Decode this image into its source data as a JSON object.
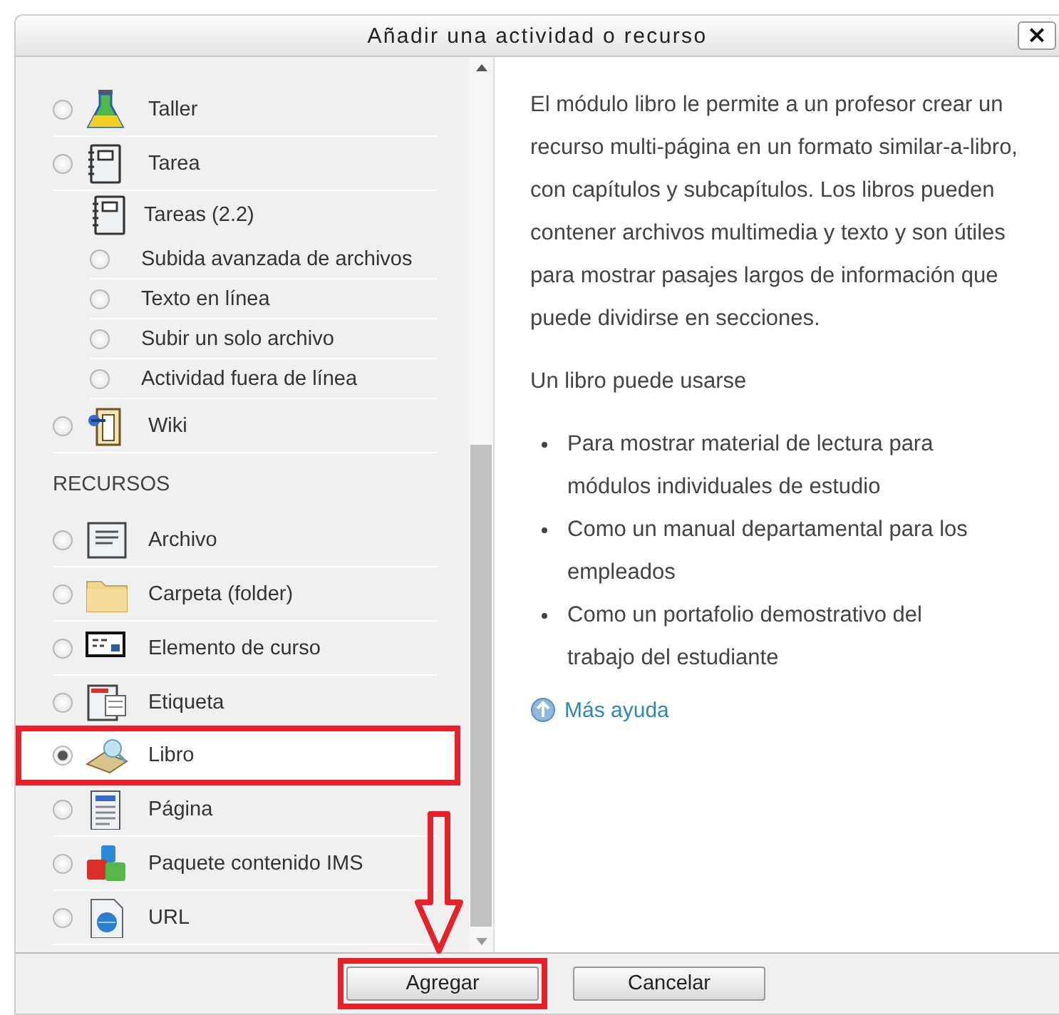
{
  "window": {
    "title": "Añadir una actividad o recurso",
    "close": "×"
  },
  "list": [
    {
      "kind": "item",
      "label": "Taller",
      "selected": false,
      "highlighted": false
    },
    {
      "kind": "item",
      "label": "Tarea",
      "selected": false,
      "highlighted": false
    },
    {
      "kind": "group",
      "label": "Tareas (2.2)",
      "children": [
        {
          "label": "Subida avanzada de archivos",
          "selected": false
        },
        {
          "label": "Texto en línea",
          "selected": false
        },
        {
          "label": "Subir un solo archivo",
          "selected": false
        },
        {
          "label": "Actividad fuera de línea",
          "selected": false
        }
      ]
    },
    {
      "kind": "item",
      "label": "Wiki",
      "selected": false,
      "highlighted": false
    },
    {
      "kind": "heading",
      "label": "RECURSOS"
    },
    {
      "kind": "item",
      "label": "Archivo",
      "selected": false,
      "highlighted": false
    },
    {
      "kind": "item",
      "label": "Carpeta (folder)",
      "selected": false,
      "highlighted": false
    },
    {
      "kind": "item",
      "label": "Elemento de curso",
      "selected": false,
      "highlighted": false
    },
    {
      "kind": "item",
      "label": "Etiqueta",
      "selected": false,
      "highlighted": false
    },
    {
      "kind": "item",
      "label": "Libro",
      "selected": true,
      "highlighted": true
    },
    {
      "kind": "item",
      "label": "Página",
      "selected": false,
      "highlighted": false
    },
    {
      "kind": "item",
      "label": "Paquete contenido IMS",
      "selected": false,
      "highlighted": false
    },
    {
      "kind": "item",
      "label": "URL",
      "selected": false,
      "highlighted": false
    }
  ],
  "description": {
    "paragraphs": [
      "El módulo libro le permite a un profesor crear un recurso multi-página en un formato similar-a-libro, con capítulos y subcapítulos. Los libros pueden contener archivos multimedia y texto y son útiles para mostrar pasajes largos de información que puede dividirse en secciones.",
      "Un libro puede usarse"
    ],
    "bullets": [
      "Para mostrar material de lectura para módulos individuales de estudio",
      "Como un manual departamental para los empleados",
      "Como un portafolio demostrativo del trabajo del estudiante"
    ],
    "help_link": "Más ayuda"
  },
  "buttons": [
    {
      "label": "Agregar",
      "highlighted": true
    },
    {
      "label": "Cancelar",
      "highlighted": false
    }
  ],
  "arrow_annotation": true
}
